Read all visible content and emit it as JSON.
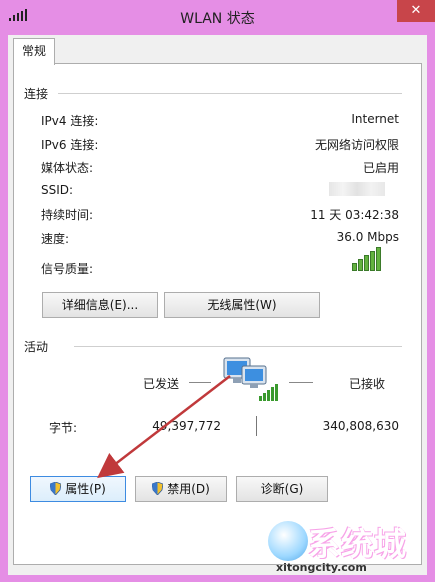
{
  "window": {
    "title": "WLAN 状态",
    "close_glyph": "✕"
  },
  "tab": {
    "label": "常规"
  },
  "connection": {
    "heading": "连接",
    "rows": [
      {
        "label": "IPv4 连接:",
        "value": "Internet"
      },
      {
        "label": "IPv6 连接:",
        "value": "无网络访问权限"
      },
      {
        "label": "媒体状态:",
        "value": "已启用"
      },
      {
        "label": "SSID:",
        "value": ""
      },
      {
        "label": "持续时间:",
        "value": "11 天 03:42:38"
      },
      {
        "label": "速度:",
        "value": "36.0 Mbps"
      }
    ],
    "signal_label": "信号质量:",
    "signal_bars": 5,
    "signal_icon": "wifi-signal-bars-icon",
    "details_button": "详细信息(E)...",
    "wireless_button": "无线属性(W)"
  },
  "activity": {
    "heading": "活动",
    "sent_label": "已发送",
    "received_label": "已接收",
    "bytes_label": "字节:",
    "bytes_sent": "49,397,772",
    "bytes_received": "340,808,630",
    "network_icon": "network-computers-icon"
  },
  "buttons": {
    "properties": "属性(P)",
    "disable": "禁用(D)",
    "diagnose": "诊断(G)"
  },
  "watermark": {
    "text": "系统城",
    "url": "xitongcity.com"
  },
  "colors": {
    "frame": "#e58ee5",
    "close": "#c8454a",
    "annotation_arrow": "#c0393b"
  }
}
